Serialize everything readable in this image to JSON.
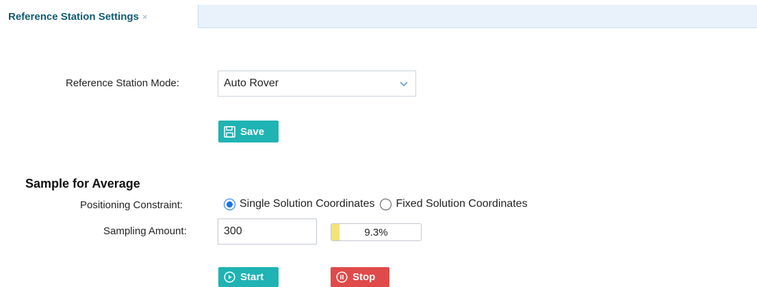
{
  "tab": {
    "label": "Reference Station Settings",
    "close_glyph": "×"
  },
  "mode": {
    "label": "Reference Station Mode:",
    "selected": "Auto Rover",
    "arrow_icon": "chevron-down-icon"
  },
  "save_button": {
    "label": "Save",
    "icon": "save-icon"
  },
  "section": {
    "title": "Sample for Average"
  },
  "constraint": {
    "label": "Positioning Constraint:",
    "options": [
      {
        "label": "Single Solution Coordinates",
        "checked": true
      },
      {
        "label": "Fixed Solution Coordinates",
        "checked": false
      }
    ]
  },
  "sampling": {
    "label": "Sampling Amount:",
    "value": "300",
    "progress_text": "9.3%",
    "progress_fraction": 0.093
  },
  "start_button": {
    "label": "Start",
    "icon": "play-circle-icon"
  },
  "stop_button": {
    "label": "Stop",
    "icon": "pause-circle-icon"
  },
  "colors": {
    "accent": "#1fb3b3",
    "danger": "#e04a4a",
    "tab_text": "#0e5a73",
    "radio": "#1a73e8",
    "progress_fill": "#f4e27a"
  }
}
